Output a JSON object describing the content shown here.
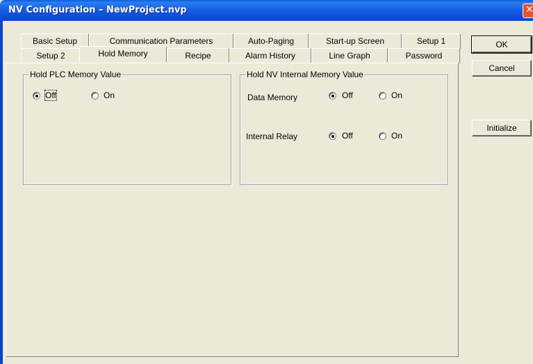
{
  "window": {
    "title": "NV Configuration – NewProject.nvp"
  },
  "tabs": {
    "row1": [
      "Basic Setup",
      "Communication Parameters",
      "Auto-Paging",
      "Start-up Screen",
      "Setup 1"
    ],
    "row2": [
      "Setup 2",
      "Hold Memory",
      "Recipe",
      "Alarm History",
      "Line Graph",
      "Password"
    ],
    "active": "Hold Memory"
  },
  "hold_plc": {
    "title": "Hold PLC Memory Value",
    "off_label": "Off",
    "on_label": "On",
    "selected": "Off"
  },
  "hold_nv": {
    "title": "Hold NV Internal Memory Value",
    "data_memory": {
      "label": "Data Memory",
      "off_label": "Off",
      "on_label": "On",
      "selected": "Off"
    },
    "internal_relay": {
      "label": "Internal Relay",
      "off_label": "Off",
      "on_label": "On",
      "selected": "Off"
    }
  },
  "buttons": {
    "ok": "OK",
    "cancel": "Cancel",
    "initialize": "Initialize"
  }
}
